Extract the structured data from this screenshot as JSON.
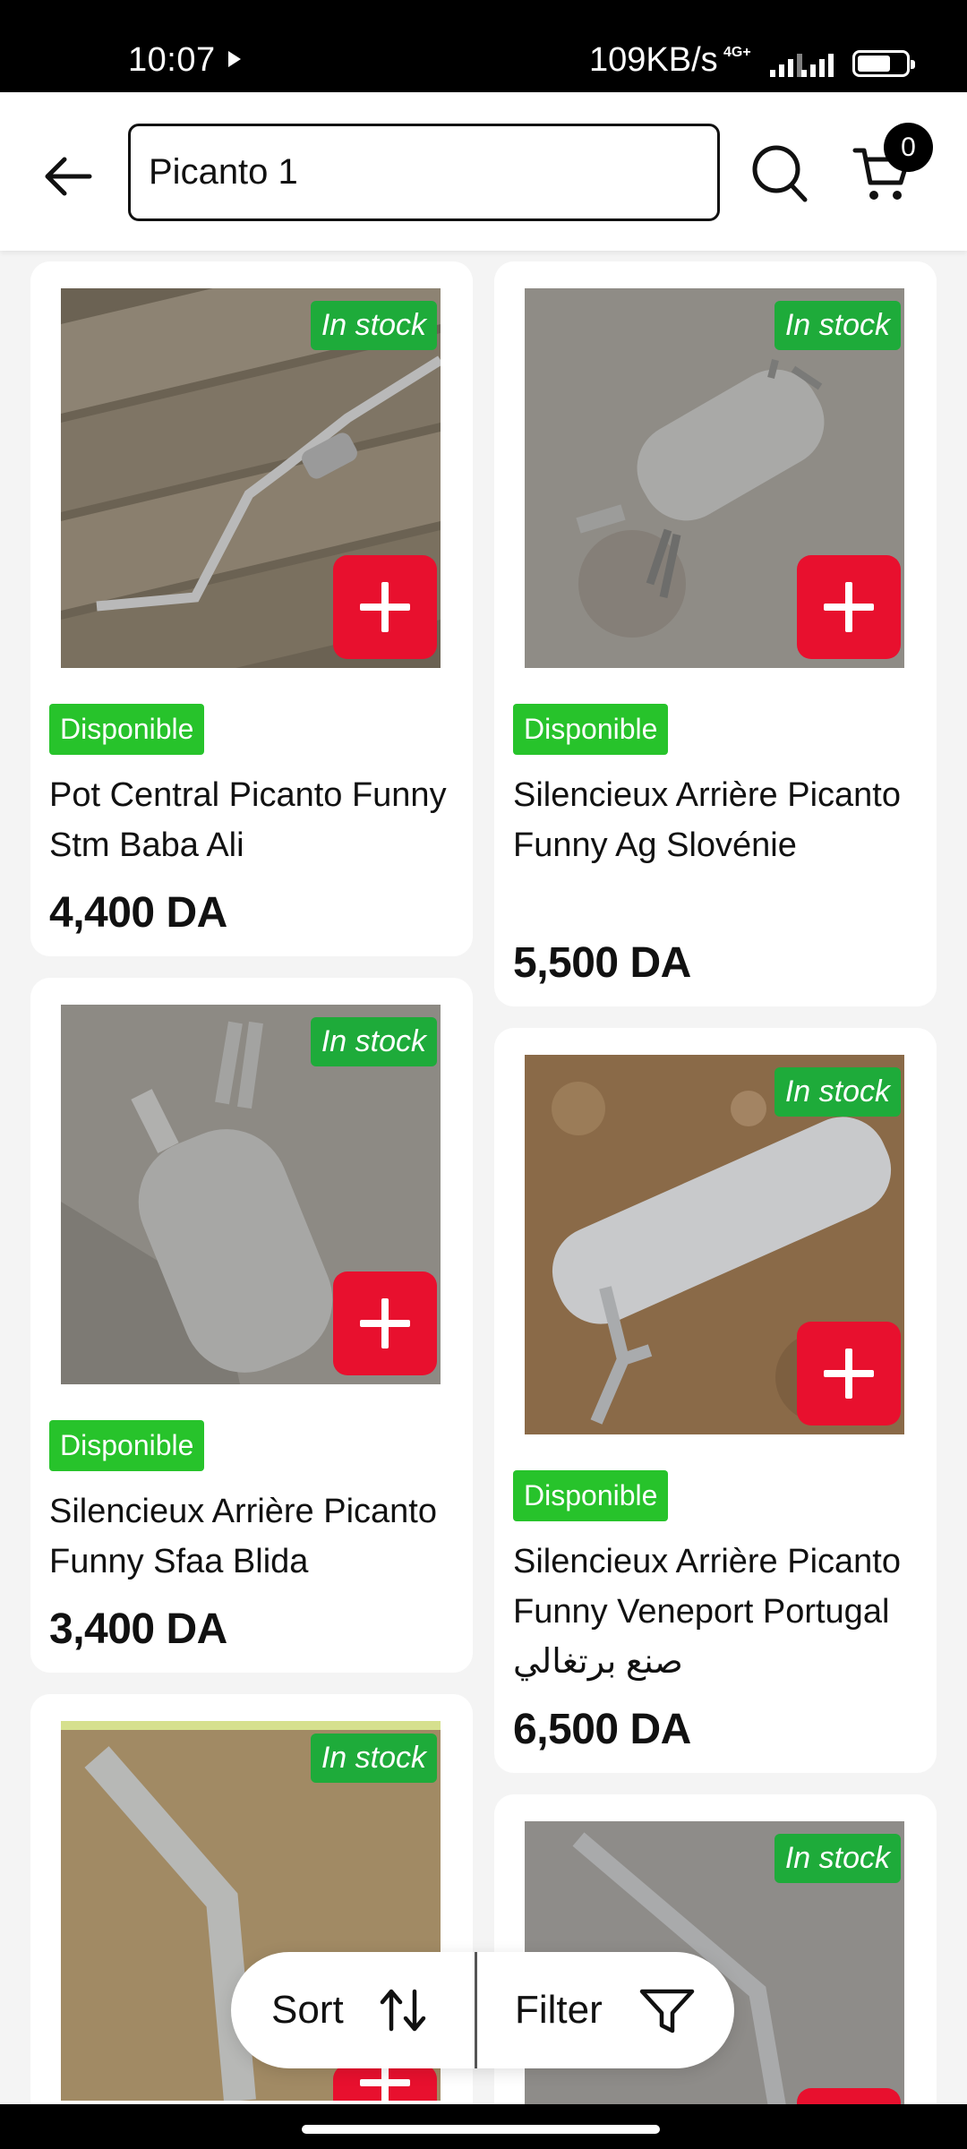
{
  "status_bar": {
    "time": "10:07",
    "speed": "109KB/s",
    "network": "4G+",
    "battery_level": 0.7
  },
  "header": {
    "search_value": "Picanto 1",
    "cart_count": "0",
    "icons": [
      "back-arrow-icon",
      "search-icon",
      "cart-icon"
    ]
  },
  "products": [
    {
      "stock": "In stock",
      "availability": "Disponible",
      "title": "Pot Central Picanto Funny Stm Baba Ali",
      "price": "4,400 DA"
    },
    {
      "stock": "In stock",
      "availability": "Disponible",
      "title": "Silencieux Arrière Picanto Funny Ag Slovénie",
      "price": "5,500 DA"
    },
    {
      "stock": "In stock",
      "availability": "Disponible",
      "title": "Silencieux Arrière Picanto Funny Sfaa Blida",
      "price": "3,400 DA"
    },
    {
      "stock": "In stock",
      "availability": "Disponible",
      "title": "Silencieux Arrière Picanto Funny Veneport Portugal صنع برتغالي",
      "price": "6,500 DA"
    },
    {
      "stock": "In stock"
    },
    {
      "stock": "In stock"
    }
  ],
  "bottom_bar": {
    "sort_label": "Sort",
    "filter_label": "Filter"
  },
  "colors": {
    "in_stock_badge": "#1eab3a",
    "available_badge": "#27c32b",
    "add_button": "#e8102e"
  }
}
